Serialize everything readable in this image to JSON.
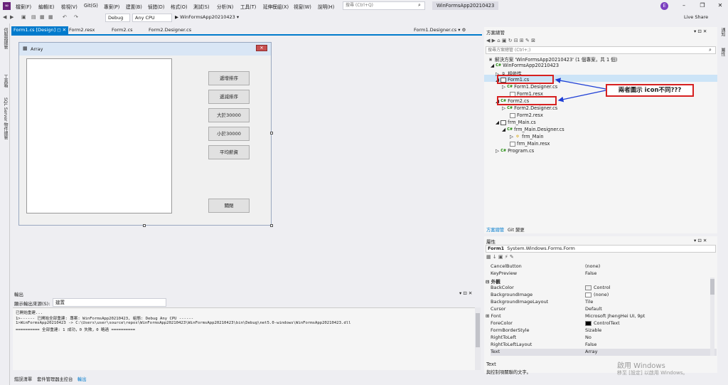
{
  "menubar": {
    "items": [
      "檔案(F)",
      "編輯(E)",
      "檢視(V)",
      "Git(G)",
      "專案(P)",
      "建置(B)",
      "偵錯(D)",
      "格式(O)",
      "測試(S)",
      "分析(N)",
      "工具(T)",
      "延伸模組(X)",
      "視窗(W)",
      "說明(H)"
    ],
    "search_placeholder": "搜尋 (Ctrl+Q)",
    "solution_name": "WinFormsApp20210423",
    "avatar_letter": "E",
    "live_share": "Live Share"
  },
  "toolbar": {
    "config": "Debug",
    "platform": "Any CPU",
    "run_target": "▶ WinFormsApp20210423 ▾"
  },
  "left_strip": [
    "伺服器總管",
    "工具箱",
    "SQL Server 物件總管"
  ],
  "right_strip": [
    "通知",
    "屬性"
  ],
  "doc_tabs": {
    "tabs": [
      "Form1.cs [Design]",
      "Form2.resx",
      "Form2.cs",
      "Form2.Designer.cs"
    ],
    "right_tab": "Form1.Designer.cs"
  },
  "form": {
    "title": "Array",
    "close_glyph": "✕",
    "buttons": [
      "遞增排序",
      "遞減排序",
      "大於30000",
      "小於30000",
      "平均薪資",
      "關閉"
    ]
  },
  "output": {
    "title": "輸出",
    "source_label": "顯示輸出來源(S):",
    "source_value": "建置",
    "lines": [
      "已開始重建...",
      "1>------ 已開始全部重建: 專案: WinFormsApp20210423, 組態: Debug Any CPU ------",
      "1>WinFormsApp20210423 -> C:\\Users\\user\\source\\repos\\WinFormsApp20210423\\WinFormsApp20210423\\bin\\Debug\\net5.0-windows\\WinFormsApp20210423.dll",
      "========== 全部重建: 1 成功，0 失敗，0 略過 =========="
    ],
    "bottom_tabs": [
      "錯誤清單",
      "套件管理器主控台",
      "輸出"
    ]
  },
  "solution_explorer": {
    "title": "方案總管",
    "search_placeholder": "搜尋方案總管 (Ctrl+;)",
    "solution_line": "解決方案 'WinFormsApp20210423' (1 個專案，共 1 個)",
    "project": "WinFormsApp20210423",
    "items": [
      {
        "label": "相依性",
        "icon": "dependency-icon"
      },
      {
        "label": "Form1.cs",
        "icon": "form-icon"
      },
      {
        "label": "Form1.Designer.cs",
        "icon": "cs-icon"
      },
      {
        "label": "Form1.resx",
        "icon": "resx-icon"
      },
      {
        "label": "Form2.cs",
        "icon": "cs-icon"
      },
      {
        "label": "Form2.Designer.cs",
        "icon": "cs-icon"
      },
      {
        "label": "Form2.resx",
        "icon": "resx-icon"
      },
      {
        "label": "frm_Main.cs",
        "icon": "form-icon"
      },
      {
        "label": "frm_Main.Designer.cs",
        "icon": "cs-icon"
      },
      {
        "label": "frm_Main",
        "icon": "class-icon"
      },
      {
        "label": "frm_Main.resx",
        "icon": "resx-icon"
      },
      {
        "label": "Program.cs",
        "icon": "cs-icon"
      }
    ],
    "annotation": "兩者圖示 icon不同???",
    "bottom_tabs": [
      "方案總管",
      "Git 變更"
    ]
  },
  "properties": {
    "title": "屬性",
    "object": "Form1",
    "object_type": "System.Windows.Forms.Form",
    "category": "外觀",
    "rows": [
      {
        "name": "CancelButton",
        "value": "(none)"
      },
      {
        "name": "KeyPreview",
        "value": "False"
      },
      {
        "name": "BackColor",
        "value": "Control"
      },
      {
        "name": "BackgroundImage",
        "value": "(none)"
      },
      {
        "name": "BackgroundImageLayout",
        "value": "Tile"
      },
      {
        "name": "Cursor",
        "value": "Default"
      },
      {
        "name": "Font",
        "value": "Microsoft JhengHei UI, 9pt"
      },
      {
        "name": "ForeColor",
        "value": "ControlText"
      },
      {
        "name": "FormBorderStyle",
        "value": "Sizable"
      },
      {
        "name": "RightToLeft",
        "value": "No"
      },
      {
        "name": "RightToLeftLayout",
        "value": "False"
      },
      {
        "name": "Text",
        "value": "Array"
      }
    ],
    "desc_title": "Text",
    "desc_text": "與控制項關聯的文字。"
  },
  "watermark": {
    "line1": "啟用 Windows",
    "line2": "移至 [設定] 以啟用 Windows。"
  },
  "colors": {
    "accent": "#007acc",
    "annotation_red": "#d62020",
    "arrow_blue": "#1f3fd6"
  }
}
